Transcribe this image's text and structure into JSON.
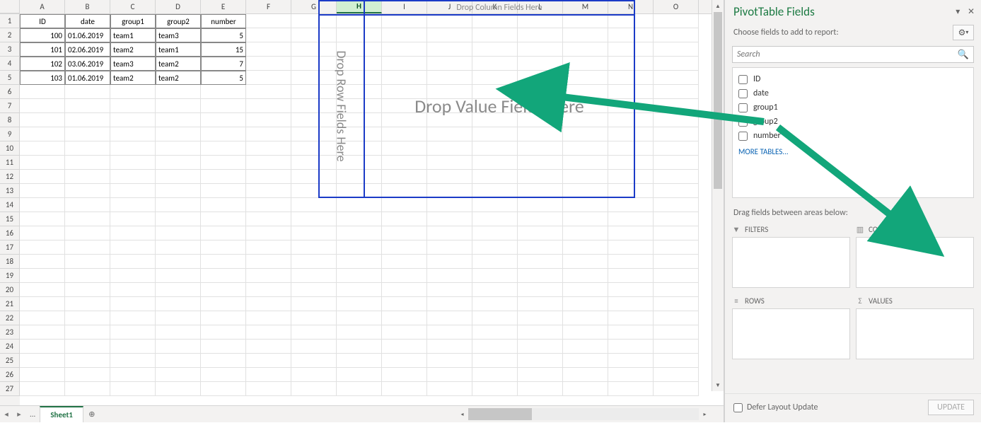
{
  "columns": [
    "A",
    "B",
    "C",
    "D",
    "E",
    "F",
    "G",
    "H",
    "I",
    "J",
    "K",
    "L",
    "M",
    "N",
    "O"
  ],
  "row_headers": [
    1,
    2,
    3,
    4,
    5,
    6,
    7,
    8,
    9,
    10,
    11,
    12,
    13,
    14,
    15,
    16,
    17,
    18,
    19,
    20,
    21,
    22,
    23,
    24,
    25,
    26,
    27
  ],
  "table": {
    "headers": [
      "ID",
      "date",
      "group1",
      "group2",
      "number"
    ],
    "rows": [
      {
        "ID": 100,
        "date": "01.06.2019",
        "group1": "team1",
        "group2": "team3",
        "number": 5
      },
      {
        "ID": 101,
        "date": "02.06.2019",
        "group1": "team2",
        "group2": "team1",
        "number": 15
      },
      {
        "ID": 102,
        "date": "03.06.2019",
        "group1": "team3",
        "group2": "team2",
        "number": 7
      },
      {
        "ID": 103,
        "date": "01.06.2019",
        "group1": "team2",
        "group2": "team2",
        "number": 5
      }
    ]
  },
  "pivot_skel": {
    "col_drop": "Drop Column Fields Here",
    "row_drop": "Drop Row Fields Here",
    "val_drop": "Drop Value Fields Here"
  },
  "sheet_tabs": {
    "more": "...",
    "active": "Sheet1"
  },
  "pane": {
    "title": "PivotTable Fields",
    "choose_label": "Choose fields to add to report:",
    "search_placeholder": "Search",
    "fields": [
      "ID",
      "date",
      "group1",
      "group2",
      "number"
    ],
    "more_tables": "MORE TABLES...",
    "drag_label": "Drag fields between areas below:",
    "areas": {
      "filters": "FILTERS",
      "columns": "COLUMNS",
      "rows": "ROWS",
      "values": "VALUES"
    },
    "defer_label": "Defer Layout Update",
    "update_btn": "UPDATE"
  }
}
